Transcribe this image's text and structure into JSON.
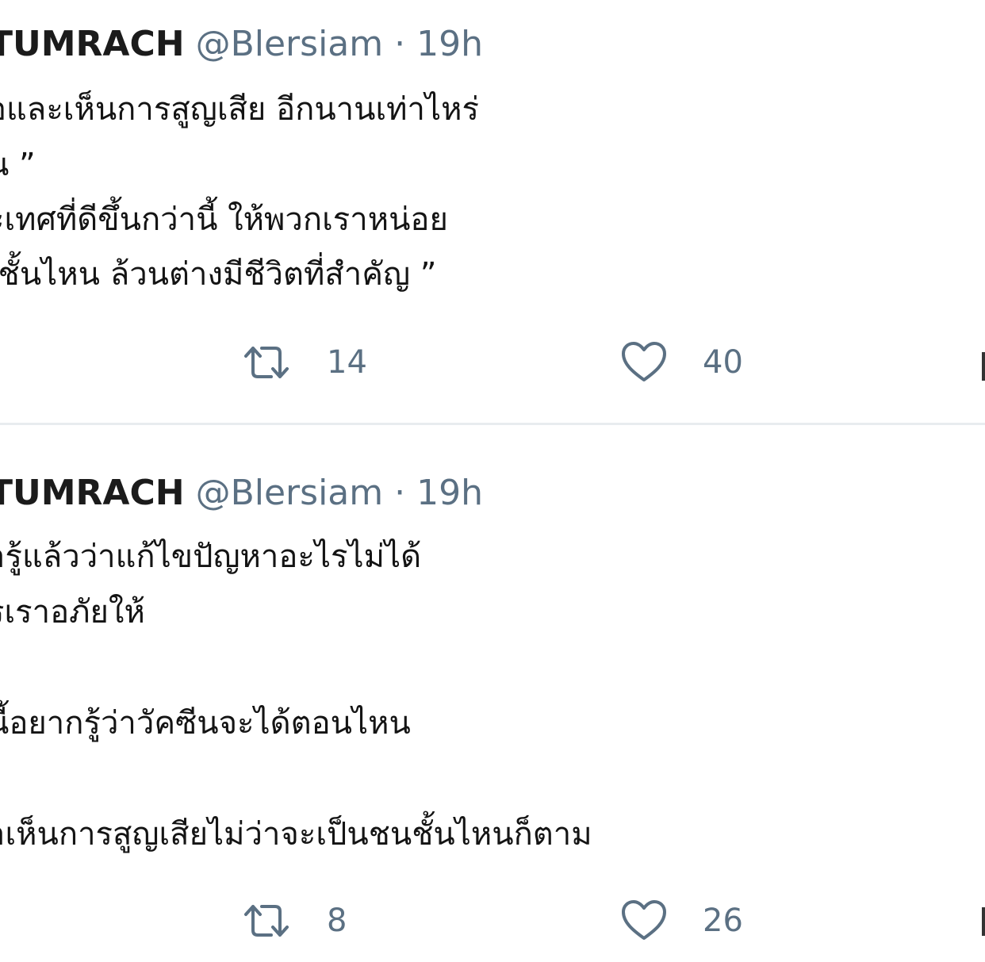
{
  "tweets": [
    {
      "author_name": "TUMRACH",
      "handle": "@Blersiam",
      "separator": "·",
      "time": "19h",
      "lines": [
        "อและเห็นการสูญเสีย อีกนานเท่าไหร่",
        "น ”",
        "ะเทศที่ดีขึ้นกว่านี้ ให้พวกเราหน่อย",
        "เชั้นไหน ล้วนต่างมีชีวิตที่สำคัญ ”"
      ],
      "retweet_count": "14",
      "like_count": "40"
    },
    {
      "author_name": "TUMRACH",
      "handle": "@Blersiam",
      "separator": "·",
      "time": "19h",
      "lines": [
        "ารู้แล้วว่าแก้ไขปัญหาอะไรไม่ได้",
        "รเราอภัยให้",
        "",
        "นี้อยากรู้ว่าวัคซีนจะได้ตอนไหน",
        "",
        "าเห็นการสูญเสียไม่ว่าจะเป็นชนชั้นไหนก็ตาม"
      ],
      "retweet_count": "8",
      "like_count": "26"
    }
  ],
  "icons": {
    "retweet": "retweet-icon",
    "like": "heart-icon"
  },
  "colors": {
    "text": "#0f1419",
    "muted": "#5b7083",
    "divider": "#e8ecef"
  }
}
